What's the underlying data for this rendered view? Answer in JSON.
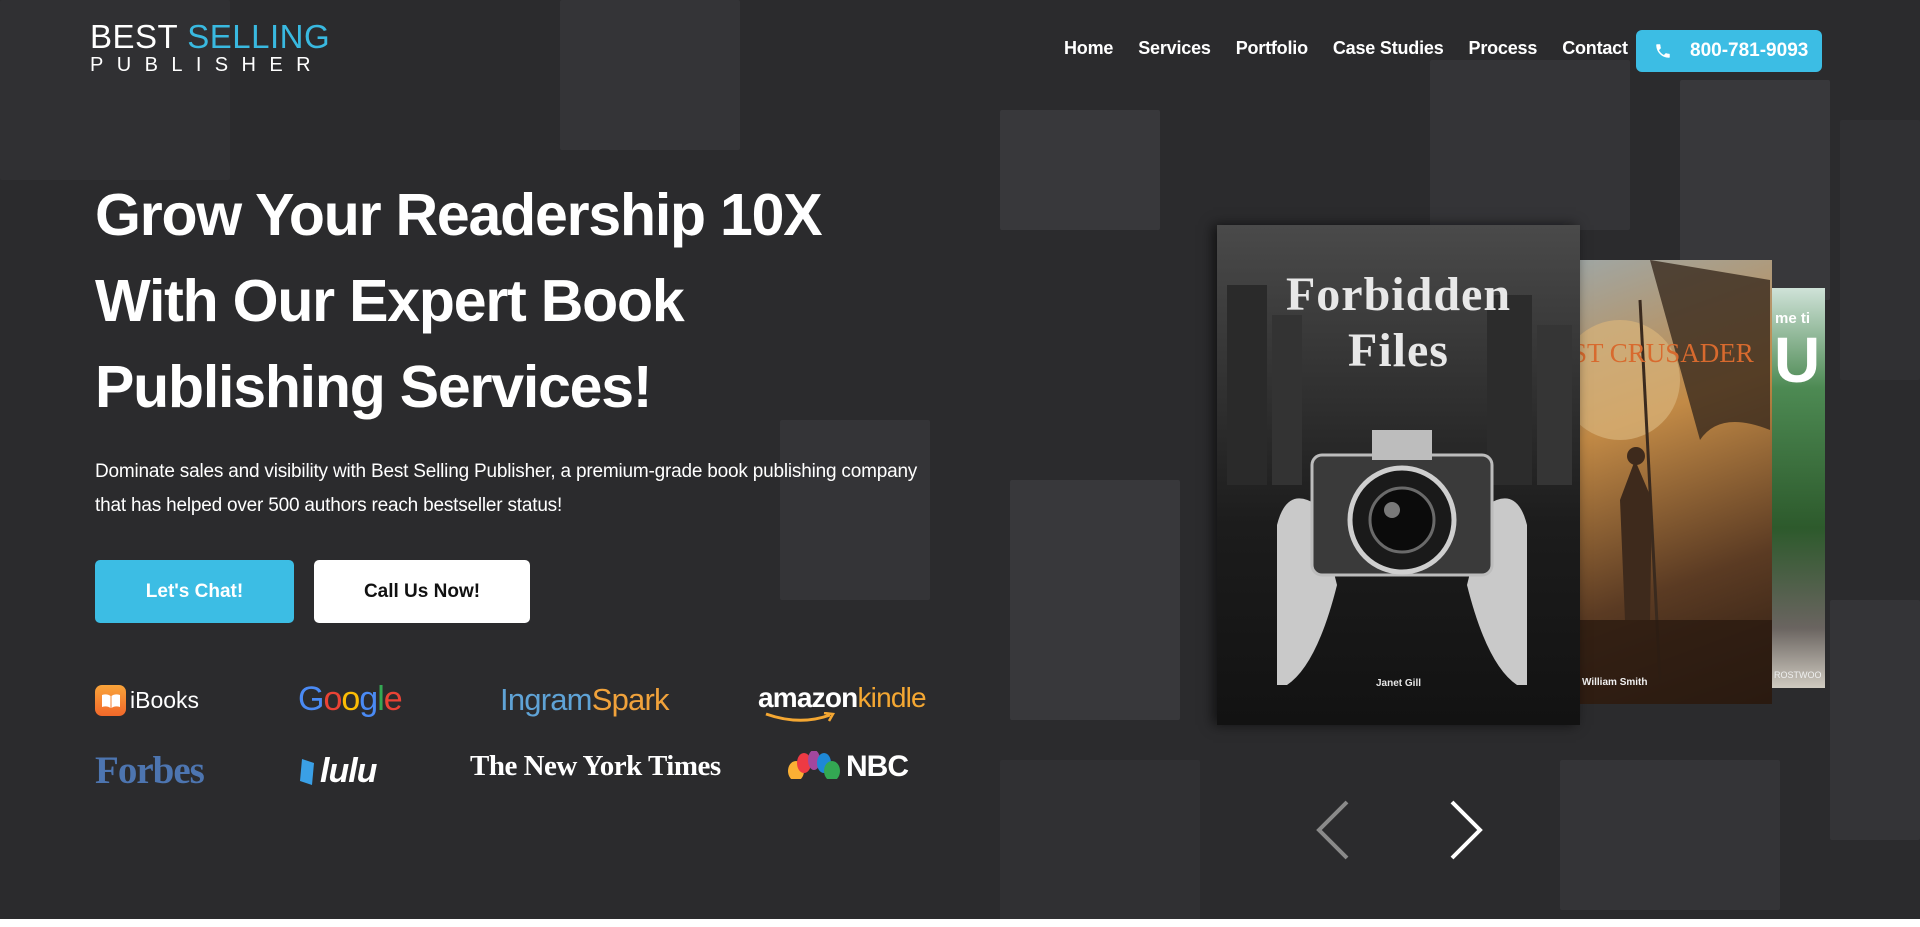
{
  "brand": {
    "line1_a": "BEST",
    "line1_b": "SELLING",
    "line2": "PUBLISHER"
  },
  "nav": {
    "items": [
      "Home",
      "Services",
      "Portfolio",
      "Case Studies",
      "Process",
      "Contact"
    ]
  },
  "phone": {
    "label": "800-781-9093",
    "icon": "phone-icon"
  },
  "hero": {
    "headline_1": "Grow Your Readership 10X",
    "headline_2": "With Our Expert Book",
    "headline_3": "Publishing Services!",
    "subcopy": "Dominate sales and visibility with Best Selling Publisher, a premium-grade book publishing company that has helped over 500 authors reach bestseller status!",
    "primary_cta": "Let's Chat!",
    "secondary_cta": "Call Us Now!"
  },
  "partners": {
    "ibooks": "iBooks",
    "google": [
      "G",
      "o",
      "o",
      "g",
      "l",
      "e"
    ],
    "ingram_a": "Ingram",
    "ingram_b": "Spark",
    "amazon_a": "amazon",
    "amazon_b": "kindle",
    "forbes": "Forbes",
    "lulu": "lulu",
    "nyt": "The New York Times",
    "nbc": "NBC"
  },
  "carousel": {
    "books": [
      {
        "title_1": "Forbidden",
        "title_2": "Files",
        "author": "Janet Gill"
      },
      {
        "title": "ST CRUSADER",
        "author": "William Smith"
      },
      {
        "title": "me ti",
        "big": "U",
        "author": "ROSTWOO"
      }
    ],
    "prev_icon": "chevron-left-icon",
    "next_icon": "chevron-right-icon"
  },
  "colors": {
    "accent": "#3cbde4",
    "background": "#2b2b2d"
  }
}
